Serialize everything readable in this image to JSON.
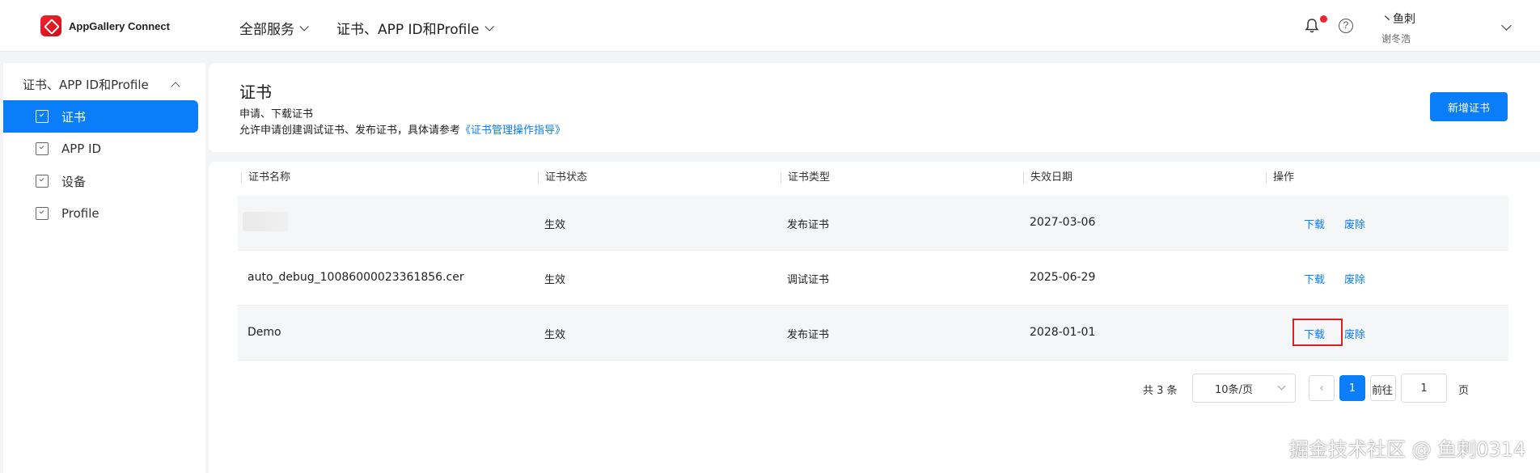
{
  "app": {
    "name": "AppGallery Connect"
  },
  "topnav": {
    "all_services": "全部服务",
    "section": "证书、APP ID和Profile"
  },
  "user": {
    "name": "丶鱼刺",
    "subname": "谢冬浩"
  },
  "help": {
    "glyph": "?"
  },
  "sidebar": {
    "group": "证书、APP ID和Profile",
    "items": [
      {
        "label": "证书",
        "active": true
      },
      {
        "label": "APP ID",
        "active": false
      },
      {
        "label": "设备",
        "active": false
      },
      {
        "label": "Profile",
        "active": false
      }
    ]
  },
  "page": {
    "title": "证书",
    "desc1": "申请、下载证书",
    "desc2_prefix": "允许申请创建调试证书、发布证书，具体请参考",
    "desc2_link": "《证书管理操作指导》",
    "new_button": "新增证书"
  },
  "table": {
    "headers": [
      "证书名称",
      "证书状态",
      "证书类型",
      "失效日期",
      "操作"
    ],
    "rows": [
      {
        "name": "",
        "status": "生效",
        "type": "发布证书",
        "expire": "2027-03-06",
        "download": "下载",
        "revoke": "废除"
      },
      {
        "name": "auto_debug_10086000023361856.cer",
        "status": "生效",
        "type": "调试证书",
        "expire": "2025-06-29",
        "download": "下载",
        "revoke": "废除"
      },
      {
        "name": "Demo",
        "status": "生效",
        "type": "发布证书",
        "expire": "2028-01-01",
        "download": "下载",
        "revoke": "废除"
      }
    ]
  },
  "pagination": {
    "total": "共 3 条",
    "page_size": "10条/页",
    "prev": "‹",
    "next": "›",
    "current": "1",
    "goto_label": "前往",
    "goto_value": "1",
    "page_suffix": "页"
  },
  "watermark": "掘金技术社区 @ 鱼刺0314",
  "colors": {
    "primary": "#0a7dfa",
    "highlight_border": "#e02020",
    "badge": "#f5222d"
  }
}
